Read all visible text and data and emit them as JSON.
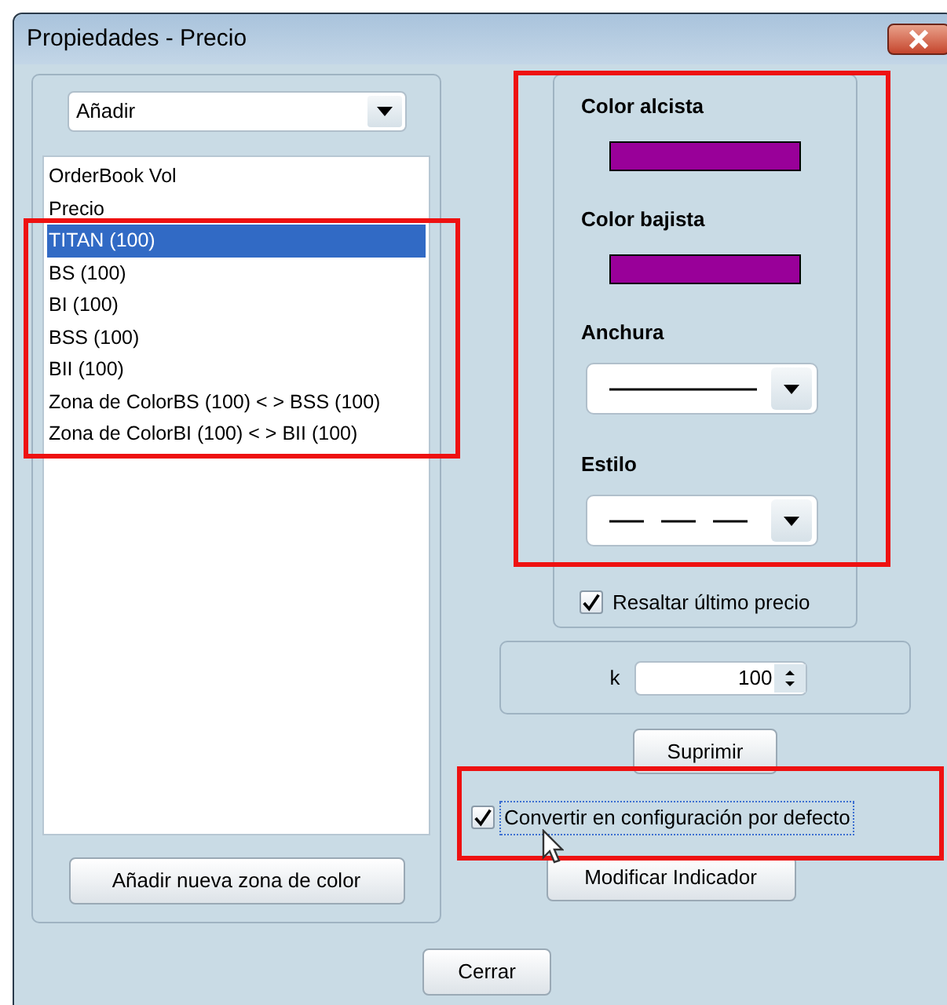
{
  "window": {
    "title": "Propiedades - Precio"
  },
  "add_dropdown": {
    "value": "Añadir"
  },
  "indicator_list": {
    "items": [
      {
        "label": "OrderBook Vol",
        "selected": false
      },
      {
        "label": "Precio",
        "selected": false
      },
      {
        "label": "TITAN (100)",
        "selected": true
      },
      {
        "label": "BS (100)",
        "selected": false
      },
      {
        "label": "BI (100)",
        "selected": false
      },
      {
        "label": "BSS (100)",
        "selected": false
      },
      {
        "label": "BII (100)",
        "selected": false
      },
      {
        "label": "Zona de ColorBS (100) < > BSS (100)",
        "selected": false
      },
      {
        "label": "Zona de ColorBI (100) < > BII (100)",
        "selected": false
      }
    ]
  },
  "add_zone_button": "Añadir nueva zona de color",
  "line_settings": {
    "colors": [
      {
        "label": "Color alcista",
        "color": "#990099"
      },
      {
        "label": "Color bajista",
        "color": "#990099"
      }
    ],
    "width": {
      "label": "Anchura",
      "kind": "solid"
    },
    "style": {
      "label": "Estilo",
      "kind": "dashed"
    }
  },
  "highlight_last_price": {
    "label": "Resaltar último precio",
    "checked": true
  },
  "k_field": {
    "label": "k",
    "value": "100"
  },
  "delete_button": "Suprimir",
  "default_config": {
    "label": "Convertir en configuración por defecto",
    "checked": true
  },
  "modify_button": "Modificar Indicador",
  "close_button": "Cerrar"
}
